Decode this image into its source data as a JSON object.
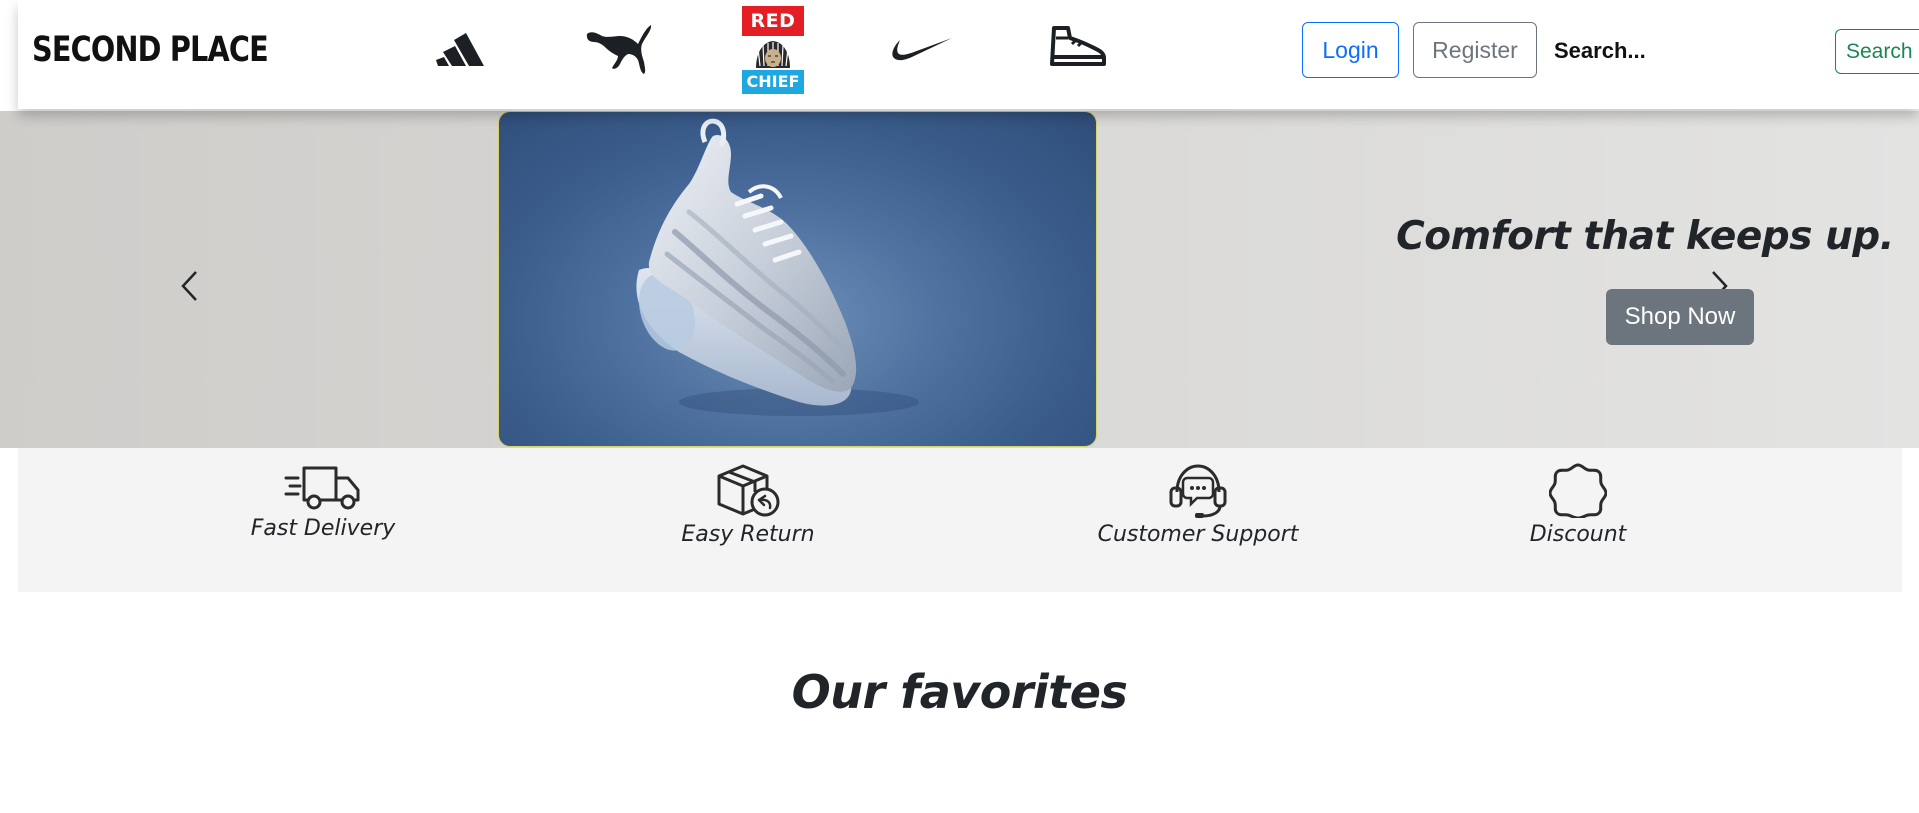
{
  "header": {
    "brand": "SECOND PLACE",
    "brand_logos": [
      {
        "name": "adidas",
        "icon": "adidas-logo"
      },
      {
        "name": "puma",
        "icon": "puma-logo"
      },
      {
        "name": "red chief",
        "icon": "red-chief-logo",
        "text_top": "RED",
        "text_bottom": "CHIEF"
      },
      {
        "name": "nike",
        "icon": "nike-swoosh-logo"
      },
      {
        "name": "sneaker",
        "icon": "sneaker-icon"
      }
    ],
    "login_label": "Login",
    "register_label": "Register",
    "search_placeholder": "Search...",
    "search_button_label": "Search"
  },
  "hero": {
    "tagline": "Comfort that keeps up.",
    "cta_label": "Shop Now",
    "prev_icon": "chevron-left-icon",
    "next_icon": "chevron-right-icon"
  },
  "features": [
    {
      "label": "Fast Delivery",
      "icon": "delivery-truck-icon"
    },
    {
      "label": "Easy Return",
      "icon": "return-box-icon"
    },
    {
      "label": "Customer Support",
      "icon": "headset-support-icon"
    },
    {
      "label": "Discount",
      "icon": "discount-badge-icon"
    }
  ],
  "section": {
    "title": "Our favorites"
  },
  "colors": {
    "primary": "#0d6efd",
    "secondary": "#6c757d",
    "success": "#198754",
    "hero_blue": "#3b5d8c",
    "red_chief_red": "#e31e24",
    "red_chief_blue": "#1fa7e1"
  }
}
